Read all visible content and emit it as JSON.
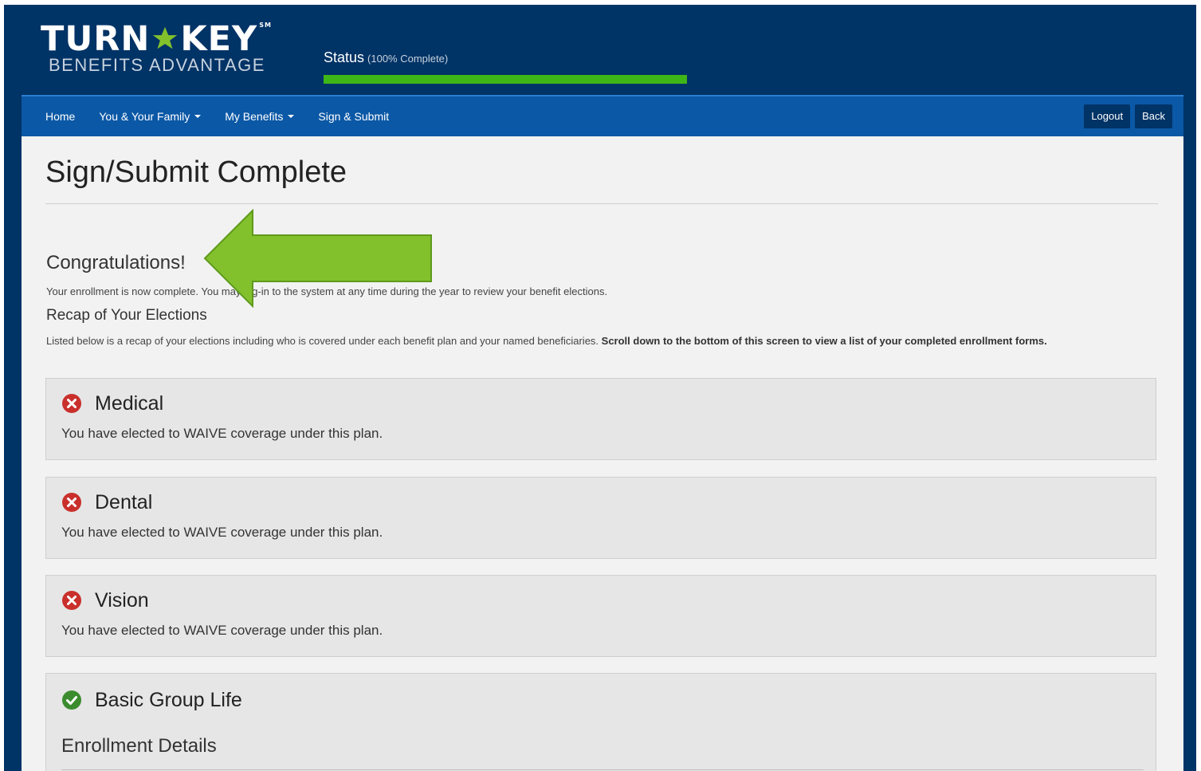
{
  "logo": {
    "line1_left": "TURN",
    "line1_right": "KEY",
    "trademark": "SM",
    "line2": "BENEFITS ADVANTAGE"
  },
  "status": {
    "label": "Status",
    "percent_text": "(100% Complete)",
    "progress": 1.0,
    "bar_color": "#3fb618"
  },
  "nav": {
    "items": [
      {
        "label": "Home",
        "dropdown": false
      },
      {
        "label": "You & Your Family",
        "dropdown": true
      },
      {
        "label": "My Benefits",
        "dropdown": true
      },
      {
        "label": "Sign & Submit",
        "dropdown": false
      }
    ],
    "logout": "Logout",
    "back": "Back"
  },
  "page": {
    "title": "Sign/Submit Complete",
    "congrats": "Congratulations!",
    "intro": "Your enrollment is now complete. You may log-in to the system at any time during the year to review your benefit elections.",
    "recap_title": "Recap of Your Elections",
    "recap_text": "Listed below is a recap of your elections including who is covered under each benefit plan and your named beneficiaries. ",
    "recap_bold": "Scroll down to the bottom of this screen to view a list of your completed enrollment forms."
  },
  "plans": [
    {
      "name": "Medical",
      "status": "waived",
      "icon": "x-circle-icon",
      "description": "You have elected to WAIVE coverage under this plan."
    },
    {
      "name": "Dental",
      "status": "waived",
      "icon": "x-circle-icon",
      "description": "You have elected to WAIVE coverage under this plan."
    },
    {
      "name": "Vision",
      "status": "waived",
      "icon": "x-circle-icon",
      "description": "You have elected to WAIVE coverage under this plan."
    },
    {
      "name": "Basic Group Life",
      "status": "enrolled",
      "icon": "check-circle-icon",
      "subheading": "Enrollment Details"
    }
  ],
  "colors": {
    "header_bg": "#003366",
    "navbar_bg": "#0b58a6",
    "waived_icon": "#c9302c",
    "enrolled_icon": "#3c8c2f",
    "arrow": "#82c12c"
  }
}
